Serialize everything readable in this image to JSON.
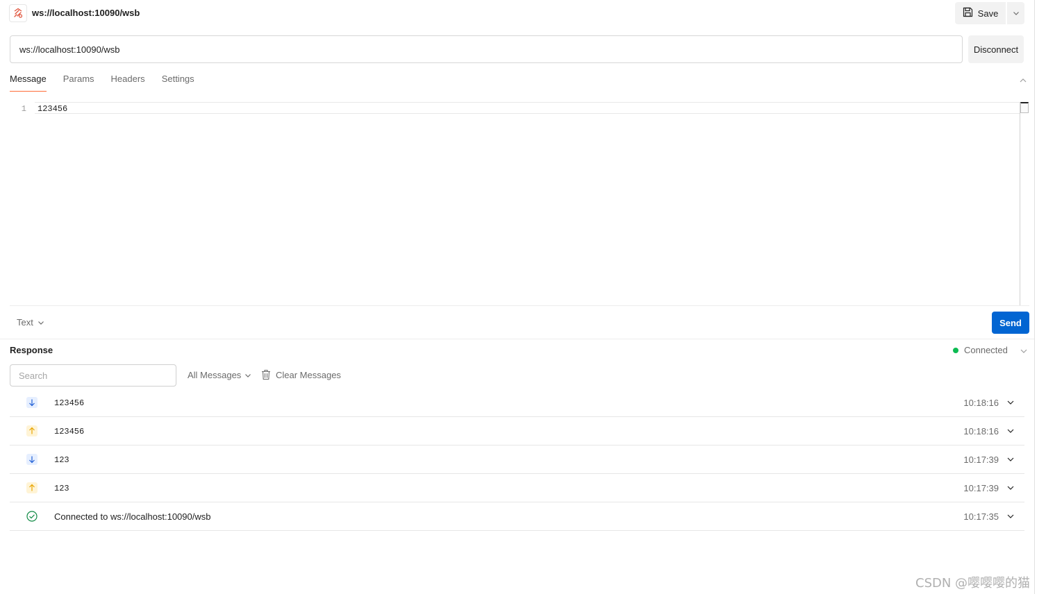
{
  "header": {
    "request_title": "ws://localhost:10090/wsb",
    "save_label": "Save"
  },
  "url_bar": {
    "value": "ws://localhost:10090/wsb",
    "disconnect_label": "Disconnect"
  },
  "tabs": [
    {
      "label": "Message",
      "active": true
    },
    {
      "label": "Params",
      "active": false
    },
    {
      "label": "Headers",
      "active": false
    },
    {
      "label": "Settings",
      "active": false
    }
  ],
  "editor": {
    "line_number": "1",
    "content": "123456"
  },
  "composer": {
    "format_label": "Text",
    "send_label": "Send"
  },
  "response": {
    "title": "Response",
    "status": "Connected",
    "status_color": "#0cbb52",
    "search_placeholder": "Search",
    "filter_label": "All Messages",
    "clear_label": "Clear Messages",
    "messages": [
      {
        "direction": "incoming",
        "icon": "arrow-down-icon",
        "text": "123456",
        "time": "10:18:16"
      },
      {
        "direction": "outgoing",
        "icon": "arrow-up-icon",
        "text": "123456",
        "time": "10:18:16"
      },
      {
        "direction": "incoming",
        "icon": "arrow-down-icon",
        "text": "123",
        "time": "10:17:39"
      },
      {
        "direction": "outgoing",
        "icon": "arrow-up-icon",
        "text": "123",
        "time": "10:17:39"
      },
      {
        "direction": "system",
        "icon": "check-circle-icon",
        "text": "Connected to ws://localhost:10090/wsb",
        "time": "10:17:35"
      }
    ]
  },
  "colors": {
    "accent": "#ff6c37",
    "send_button": "#0265d2",
    "incoming_arrow": "#1f5fd6",
    "outgoing_arrow": "#e8a400",
    "connected_check": "#0f8a44"
  },
  "watermark": "CSDN @嘤嘤嘤的猫"
}
